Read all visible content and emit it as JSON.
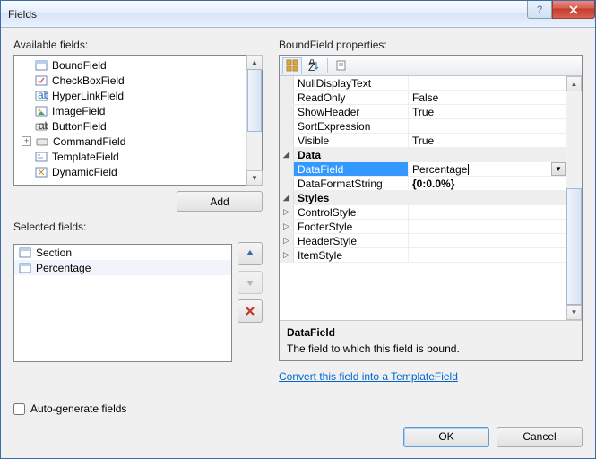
{
  "window": {
    "title": "Fields"
  },
  "labels": {
    "available": "Available fields:",
    "selected": "Selected fields:",
    "properties": "BoundField properties:",
    "add": "Add",
    "autogen": "Auto-generate fields",
    "convert": "Convert this field into a TemplateField",
    "ok": "OK",
    "cancel": "Cancel"
  },
  "available_fields": [
    "BoundField",
    "CheckBoxField",
    "HyperLinkField",
    "ImageField",
    "ButtonField",
    "CommandField",
    "TemplateField",
    "DynamicField"
  ],
  "selected_fields": [
    "Section",
    "Percentage"
  ],
  "prop_rows": [
    {
      "name": "NullDisplayText",
      "val": ""
    },
    {
      "name": "ReadOnly",
      "val": "False"
    },
    {
      "name": "ShowHeader",
      "val": "True"
    },
    {
      "name": "SortExpression",
      "val": ""
    },
    {
      "name": "Visible",
      "val": "True"
    }
  ],
  "cat_data": "Data",
  "data_rows": {
    "DataField": "Percentage",
    "DataFormatString": "{0:0.0%}"
  },
  "cat_styles": "Styles",
  "style_rows": [
    "ControlStyle",
    "FooterStyle",
    "HeaderStyle",
    "ItemStyle"
  ],
  "desc": {
    "title": "DataField",
    "text": "The field to which this field is bound."
  }
}
